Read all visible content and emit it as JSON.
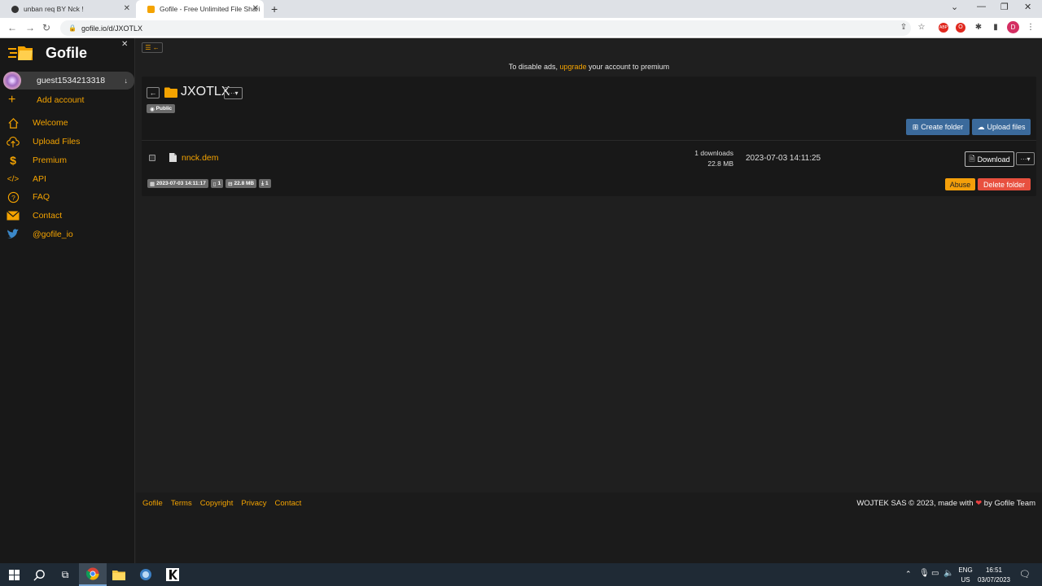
{
  "browser": {
    "tabs": [
      {
        "title": "unban req BY Nck !",
        "active": false
      },
      {
        "title": "Gofile - Free Unlimited File Shari",
        "active": true
      }
    ],
    "url": "gofile.io/d/JXOTLX",
    "profile_initial": "D"
  },
  "sidebar": {
    "logo_text": "Gofile",
    "account_name": "guest1534213318",
    "add_account": "Add account",
    "items": [
      {
        "label": "Welcome",
        "icon": "home-icon"
      },
      {
        "label": "Upload Files",
        "icon": "cloud-upload-icon"
      },
      {
        "label": "Premium",
        "icon": "dollar-icon"
      },
      {
        "label": "API",
        "icon": "code-icon"
      },
      {
        "label": "FAQ",
        "icon": "question-icon"
      },
      {
        "label": "Contact",
        "icon": "envelope-icon"
      },
      {
        "label": "@gofile_io",
        "icon": "twitter-icon"
      }
    ]
  },
  "main": {
    "ad_prefix": "To disable ads,",
    "ad_link": "upgrade",
    "ad_suffix": "your account to premium",
    "folder_name": "JXOTLX",
    "public_badge": "Public",
    "create_folder": "Create folder",
    "upload_files": "Upload files",
    "file": {
      "name": "nnck.dem",
      "downloads": "1 downloads",
      "size": "22.8 MB",
      "date": "2023-07-03 14:11:25",
      "download_label": "Download"
    },
    "stats": {
      "created": "2023-07-03 14:11:17",
      "files": "1",
      "size": "22.8 MB",
      "downloads": "1"
    },
    "abuse": "Abuse",
    "delete_folder": "Delete folder"
  },
  "footer": {
    "links": [
      "Gofile",
      "Terms",
      "Copyright",
      "Privacy",
      "Contact"
    ],
    "copyright_prefix": "WOJTEK SAS © 2023, made with",
    "copyright_suffix": "by Gofile Team"
  },
  "taskbar": {
    "lang": "ENG",
    "region": "US",
    "time": "16:51",
    "date": "03/07/2023"
  },
  "colors": {
    "accent": "#f4a300",
    "button_blue": "#3b6a9b",
    "abuse": "#f49f0a",
    "delete": "#e8503f"
  }
}
